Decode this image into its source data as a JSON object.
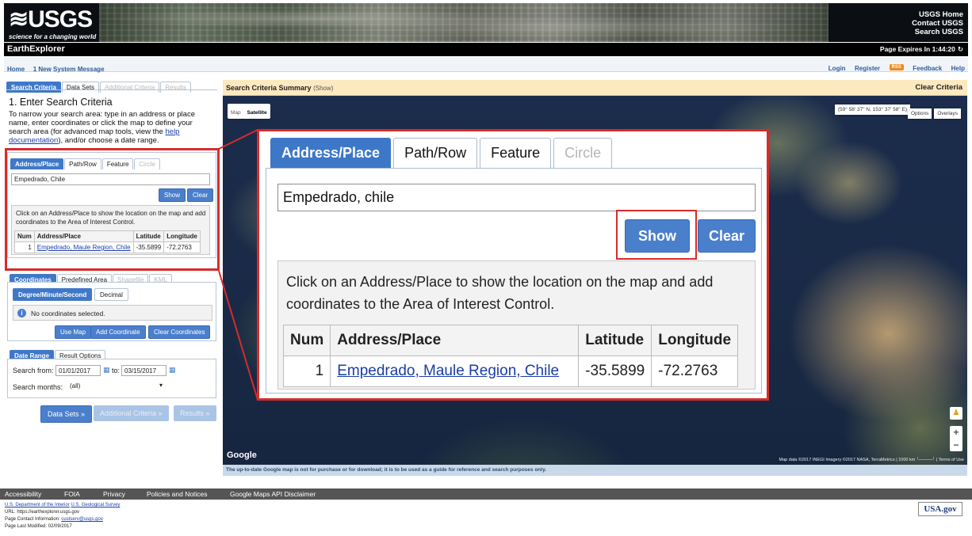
{
  "header": {
    "logo_text": "≋USGS",
    "tagline": "science for a changing world",
    "links": [
      "USGS Home",
      "Contact USGS",
      "Search USGS"
    ]
  },
  "appbar": {
    "title": "EarthExplorer",
    "page_expires": "Page Expires In 1:44:20",
    "refresh_icon": "↻"
  },
  "nav": {
    "home": "Home",
    "system_message": "1 New System Message",
    "login": "Login",
    "register": "Register",
    "rss": "RSS",
    "feedback": "Feedback",
    "help": "Help"
  },
  "main_tabs": [
    {
      "label": "Search Criteria",
      "state": "active"
    },
    {
      "label": "Data Sets",
      "state": "normal"
    },
    {
      "label": "Additional Criteria",
      "state": "disabled"
    },
    {
      "label": "Results",
      "state": "disabled"
    }
  ],
  "step": {
    "title": "1. Enter Search Criteria",
    "desc_before": "To narrow your search area: type in an address or place name, enter coordinates or click the map to define your search area (for advanced map tools, view the ",
    "desc_link": "help documentation",
    "desc_after": "), and/or choose a date range."
  },
  "place_tabs": [
    {
      "label": "Address/Place",
      "state": "active"
    },
    {
      "label": "Path/Row",
      "state": "normal"
    },
    {
      "label": "Feature",
      "state": "normal"
    },
    {
      "label": "Circle",
      "state": "disabled"
    }
  ],
  "place_search": {
    "value": "Empedrado, Chile",
    "show_label": "Show",
    "clear_label": "Clear",
    "hint": "Click on an Address/Place to show the location on the map and add coordinates to the Area of Interest Control.",
    "columns": [
      "Num",
      "Address/Place",
      "Latitude",
      "Longitude"
    ],
    "rows": [
      {
        "num": "1",
        "place": "Empedrado, Maule Region, Chile",
        "lat": "-35.5899",
        "lon": "-72.2763"
      }
    ]
  },
  "coord_tabs": [
    {
      "label": "Coordinates",
      "state": "active"
    },
    {
      "label": "Predefined Area",
      "state": "normal"
    },
    {
      "label": "Shapefile",
      "state": "disabled"
    },
    {
      "label": "KML",
      "state": "disabled"
    }
  ],
  "coords": {
    "format_dms": "Degree/Minute/Second",
    "format_dec": "Decimal",
    "empty_message": "No coordinates selected.",
    "use_map": "Use Map",
    "add_coordinate": "Add Coordinate",
    "clear_coordinates": "Clear Coordinates"
  },
  "date_tabs": [
    {
      "label": "Date Range",
      "state": "active"
    },
    {
      "label": "Result Options",
      "state": "normal"
    }
  ],
  "dates": {
    "search_from_label": "Search from:",
    "from": "01/01/2017",
    "to_label": "to:",
    "to": "03/15/2017",
    "months_label": "Search months:",
    "months_value": "(all)"
  },
  "nav_buttons": {
    "data_sets": "Data Sets »",
    "additional": "Additional Criteria »",
    "results": "Results »"
  },
  "map": {
    "summary_title": "Search Criteria Summary",
    "summary_show": "(Show)",
    "clear_criteria": "Clear Criteria",
    "type_map": "Map",
    "type_satellite": "Satellite",
    "coord_readout": "(59° 58' 37\" N, 153° 37' 58\" E)",
    "options": "Options",
    "overlays": "Overlays",
    "google": "Google",
    "attribution": "Map data ©2017 INEGI Imagery ©2017 NASA, TerraMetrics | 1000 km └────┘ | Terms of Use",
    "disclaimer": "The up-to-date Google map is not for purchase or for download; it is to be used as a guide for reference and search purposes only."
  },
  "footer": {
    "links": [
      "Accessibility",
      "FOIA",
      "Privacy",
      "Policies and Notices",
      "Google Maps API Disclaimer"
    ],
    "dept_link": "U.S. Department of the Interior",
    "usgs_link": "U.S. Geological Survey",
    "url_line": "URL: https://earthexplorer.usgs.gov",
    "contact_label": "Page Contact Information:",
    "contact_link": "custserv@usgs.gov",
    "modified": "Page Last Modified: 02/09/2017",
    "usagov": "USA.gov"
  },
  "zoom_callout": {
    "tabs": [
      {
        "label": "Address/Place",
        "state": "active"
      },
      {
        "label": "Path/Row",
        "state": "normal"
      },
      {
        "label": "Feature",
        "state": "normal"
      },
      {
        "label": "Circle",
        "state": "disabled"
      }
    ],
    "value": "Empedrado, chile",
    "show_label": "Show",
    "clear_label": "Clear",
    "hint": "Click on an Address/Place to show the location on the map and add coordinates to the Area of Interest Control.",
    "columns": [
      "Num",
      "Address/Place",
      "Latitude",
      "Longitude"
    ],
    "rows": [
      {
        "num": "1",
        "place": "Empedrado, Maule Region, Chile",
        "lat": "-35.5899",
        "lon": "-72.2763"
      }
    ]
  },
  "colors": {
    "highlight": "#d82b2b",
    "tab_active": "#3f78c7",
    "button_blue": "#4a7fcc"
  }
}
